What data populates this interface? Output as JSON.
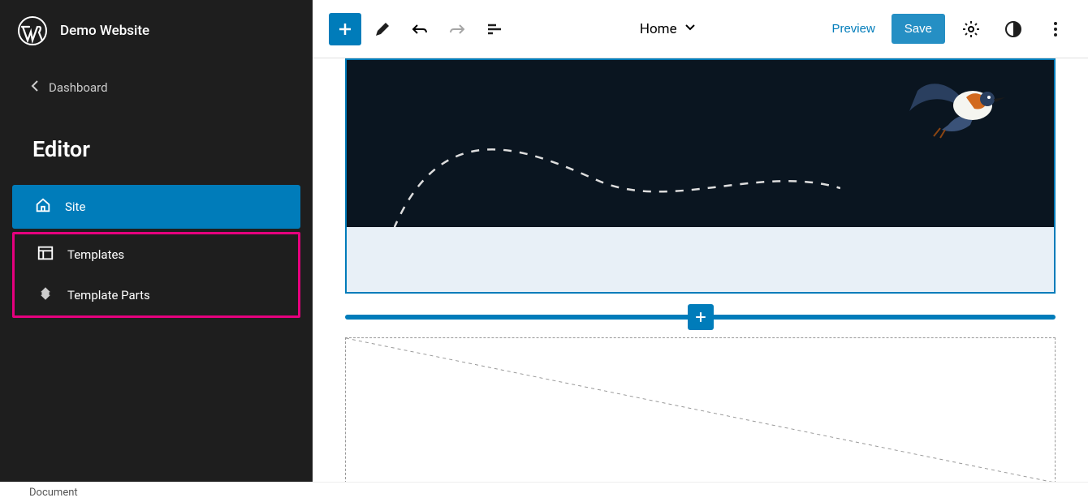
{
  "sidebar": {
    "site_title": "Demo Website",
    "back_label": "Dashboard",
    "heading": "Editor",
    "nav": [
      {
        "label": "Site",
        "active": true
      },
      {
        "label": "Templates",
        "active": false
      },
      {
        "label": "Template Parts",
        "active": false
      }
    ]
  },
  "toolbar": {
    "document_title": "Home",
    "preview_label": "Preview",
    "save_label": "Save"
  },
  "colors": {
    "accent": "#007cba",
    "highlight": "#e6007e",
    "dark_bg": "#0a1520"
  },
  "footer": {
    "label": "Document"
  }
}
